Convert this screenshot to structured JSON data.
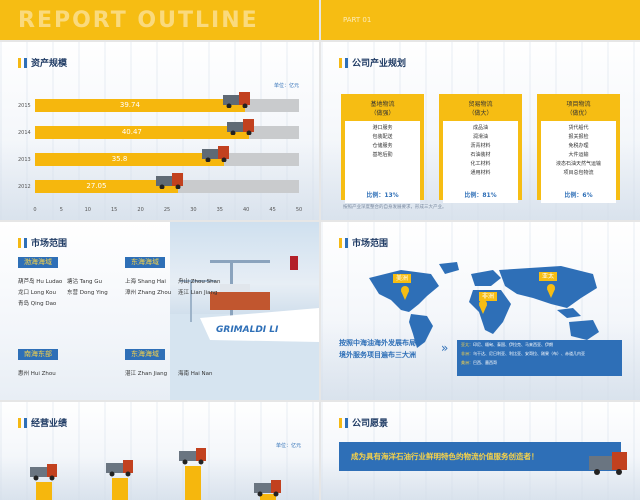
{
  "slides": {
    "cover": {
      "bg_title": "REPORT OUTLINE"
    },
    "cover2": {
      "part_label": "PART 01"
    },
    "assets": {
      "title": "资产规模",
      "unit": "单位：亿元",
      "chart_data": {
        "type": "bar",
        "orientation": "horizontal",
        "categories": [
          "2015",
          "2014",
          "2013",
          "2012"
        ],
        "values": [
          39.74,
          40.47,
          35.8,
          27.05
        ],
        "xlim": [
          0,
          50
        ],
        "xticks": [
          "0",
          "5",
          "10",
          "15",
          "20",
          "25",
          "30",
          "35",
          "40",
          "45",
          "50"
        ]
      }
    },
    "plan": {
      "title": "公司产业规划",
      "cards": [
        {
          "h1": "基地物流",
          "h2": "（做强）",
          "items": [
            "港口服务",
            "包装配送",
            "仓储服务",
            "基地后勤"
          ],
          "pct": "比例：13%"
        },
        {
          "h1": "贸易物流",
          "h2": "（做大）",
          "items": [
            "成品油",
            "润滑油",
            "沥青材料",
            "石油装材",
            "化工材料",
            "通用材料"
          ],
          "pct": "比例：81%"
        },
        {
          "h1": "项目物流",
          "h2": "（做优）",
          "items": [
            "货代船代",
            "报关报检",
            "免税办理",
            "大件运输",
            "液态石油天然气运输",
            "项目总包物流"
          ],
          "pct": "比例：6%"
        }
      ],
      "note": "按照产业深度整合的自身发展要求，形成三大产业。"
    },
    "market1": {
      "title": "市场范围",
      "regions": [
        {
          "name": "渤海海域",
          "places": [
            "葫芦岛 Hu Ludao",
            "塘沽 Tang Gu",
            "龙口 Long Kou",
            "东营 Dong Ying",
            "青岛 Qing Dao"
          ]
        },
        {
          "name": "东海海域",
          "places": [
            "上海 Shang Hai",
            "舟山 Zhou Shan",
            "漳州 Zhang Zhou",
            "连江 Lian Jiang"
          ]
        },
        {
          "name": "南海东部",
          "places": [
            "惠州 Hui Zhou"
          ]
        },
        {
          "name": "东海海域",
          "places": [
            "湛江 Zhan Jiang",
            "海南 Hai Nan"
          ]
        }
      ],
      "ship_text": "GRIMALDI LI"
    },
    "market2": {
      "title": "市场范围",
      "labels": {
        "america": "美洲",
        "africa": "非洲",
        "asia": "亚太"
      },
      "tagline": [
        "按照中海油海外发展布局",
        "境外服务项目遍布三大洲"
      ],
      "info": [
        {
          "k": "亚太：",
          "v": "印尼、缅甸、泰国、伊拉克、马来西亚、伊朗"
        },
        {
          "k": "非洲：",
          "v": "乌干达、尼日利亚、利比亚、安哥拉、刚果（布）、赤道几内亚"
        },
        {
          "k": "美洲：",
          "v": "巴西、墨西哥"
        }
      ]
    },
    "perf": {
      "title": "经营业绩",
      "unit": "单位：亿元"
    },
    "vision": {
      "title": "公司愿景",
      "statement": "成为具有海洋石油行业鲜明特色的物流价值服务创造者！"
    }
  },
  "colors": {
    "accent_yellow": "#f6bd13",
    "accent_blue": "#2e6fb7",
    "title_navy": "#1f3b64"
  }
}
